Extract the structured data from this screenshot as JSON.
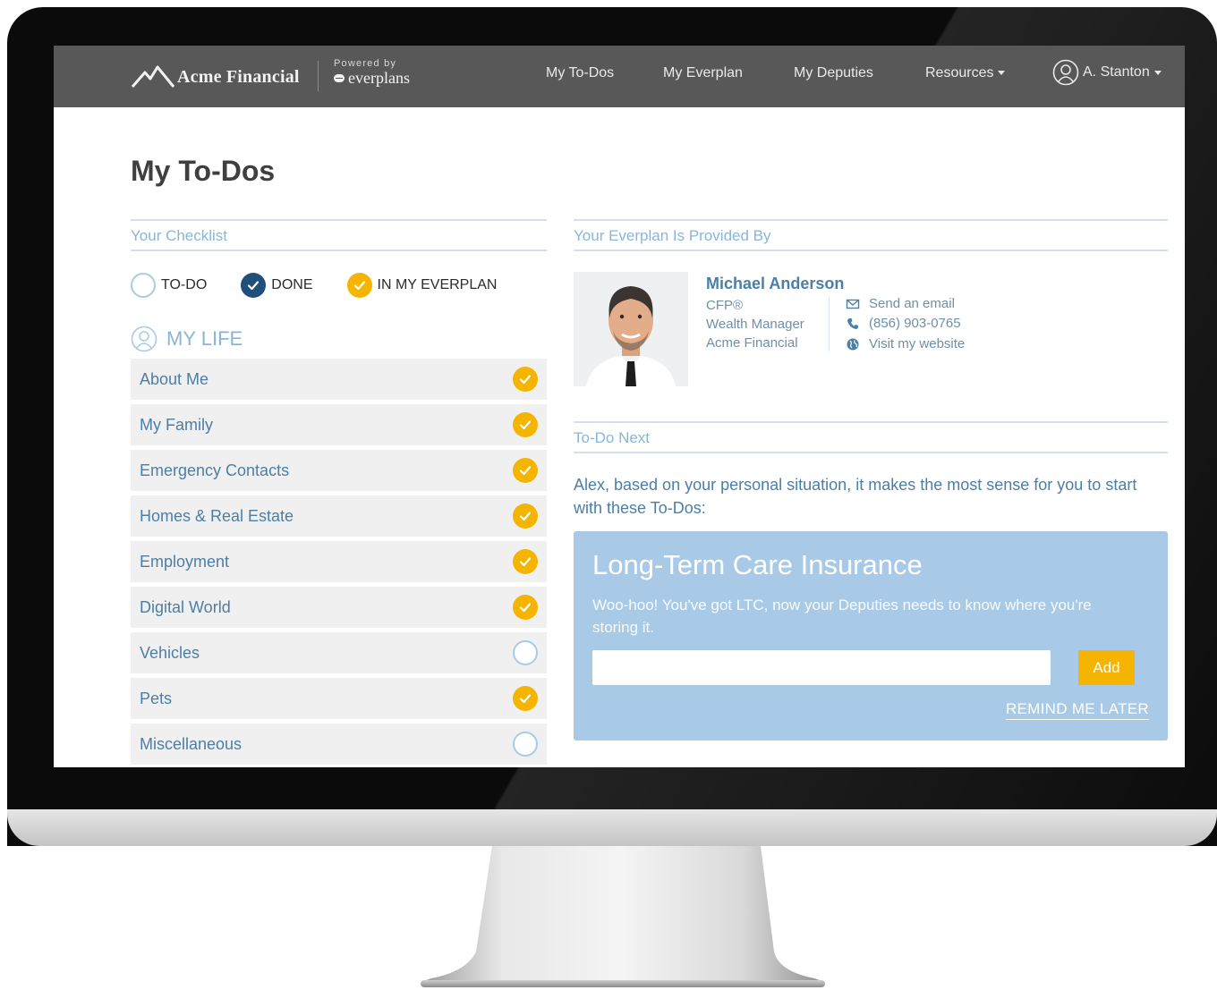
{
  "brand": {
    "name": "Acme Financial",
    "powered_label": "Powered by",
    "powered_name": "everplans"
  },
  "nav": {
    "items": [
      {
        "label": "My To-Dos"
      },
      {
        "label": "My Everplan"
      },
      {
        "label": "My Deputies"
      },
      {
        "label": "Resources"
      }
    ],
    "user": "A. Stanton"
  },
  "page": {
    "title": "My To-Dos"
  },
  "checklist": {
    "heading": "Your Checklist",
    "legend": {
      "todo": "TO-DO",
      "done": "DONE",
      "everplan": "IN MY EVERPLAN"
    },
    "section": "MY LIFE",
    "items": [
      {
        "label": "About Me",
        "status": "in-everplan"
      },
      {
        "label": "My Family",
        "status": "in-everplan"
      },
      {
        "label": "Emergency Contacts",
        "status": "in-everplan"
      },
      {
        "label": "Homes & Real Estate",
        "status": "in-everplan"
      },
      {
        "label": "Employment",
        "status": "in-everplan"
      },
      {
        "label": "Digital World",
        "status": "in-everplan"
      },
      {
        "label": "Vehicles",
        "status": "to-do"
      },
      {
        "label": "Pets",
        "status": "in-everplan"
      },
      {
        "label": "Miscellaneous",
        "status": "to-do"
      }
    ]
  },
  "provider": {
    "heading": "Your Everplan Is Provided By",
    "name": "Michael Anderson",
    "credential": "CFP®",
    "role": "Wealth Manager",
    "company": "Acme Financial",
    "email_label": "Send an email",
    "phone": "(856) 903-0765",
    "website_label": "Visit my website"
  },
  "todo_next": {
    "heading": "To-Do Next",
    "intro": "Alex, based on your personal situation, it makes the most sense for you to start with these To-Dos:",
    "card": {
      "title": "Long-Term Care Insurance",
      "text": "Woo-hoo! You've got LTC, now your Deputies needs to know where you're storing it.",
      "input_value": "",
      "add_label": "Add",
      "remind_label": "REMIND ME LATER"
    }
  },
  "colors": {
    "navbar": "#585858",
    "accent_blue": "#4d7ea6",
    "section_blue": "#8ab6d6",
    "done_navy": "#1f4f7a",
    "everplan_yellow": "#f4b400",
    "card_blue": "#a9cae6"
  },
  "icons": {
    "logo": "mountain-logo-icon",
    "avatar": "user-circle-icon",
    "check": "checkmark-icon",
    "email": "envelope-icon",
    "phone": "phone-icon",
    "website": "globe-icon"
  }
}
